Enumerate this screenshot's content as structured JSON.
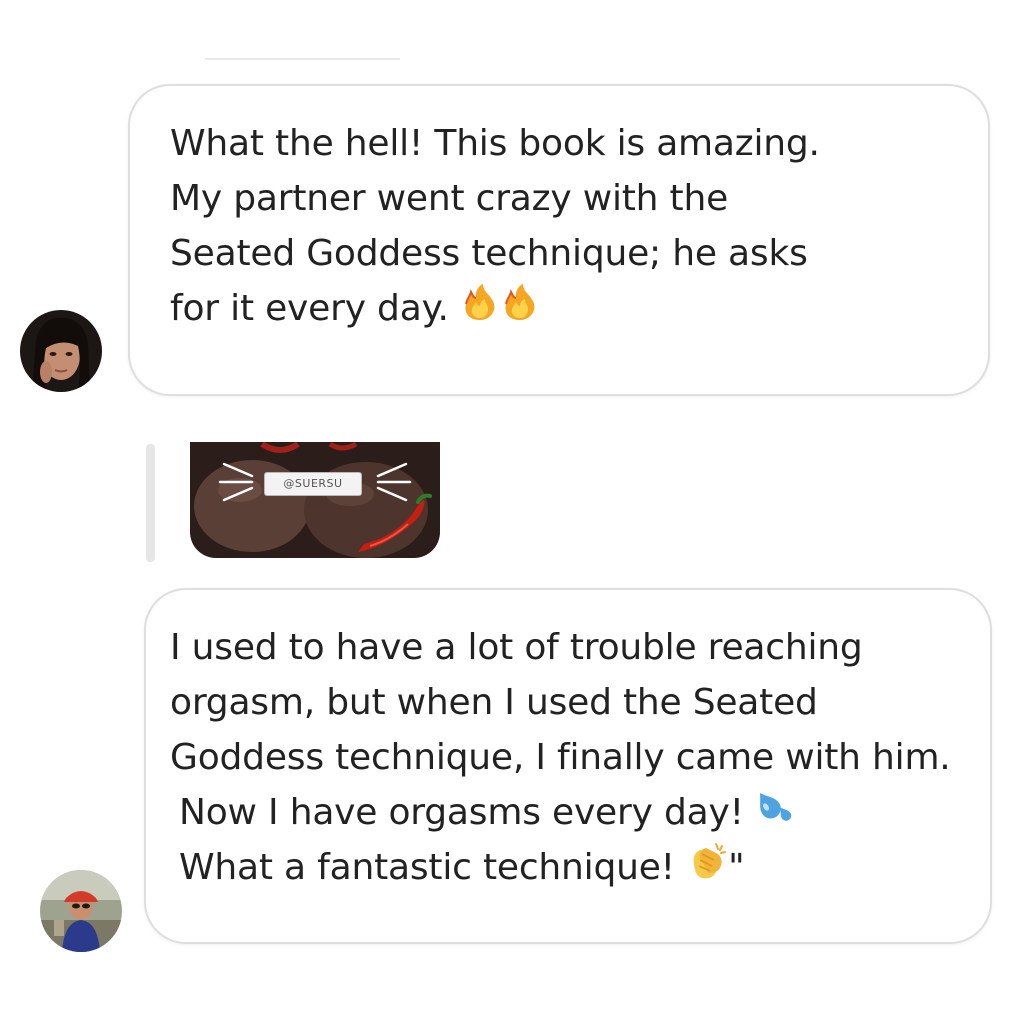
{
  "messages": [
    {
      "lines": [
        "What the hell! This book is amazing.",
        "My partner went crazy with the",
        "Seated Goddess technique; he asks",
        "for it every day."
      ],
      "emoji": [
        "fire-icon",
        "fire-icon"
      ]
    },
    {
      "lines": [
        "I used to have a lot of trouble reaching",
        "orgasm, but when I used the Seated",
        "Goddess technique, I finally came with him.",
        "Now I have orgasms every day!",
        "What a fantastic technique!"
      ],
      "trailing_text": "\"",
      "emoji": [
        "sweat-droplets-icon",
        "clapping-hands-icon"
      ]
    }
  ],
  "sticker": {
    "label": "@SUERSU"
  },
  "colors": {
    "bubble_border": "#dedede",
    "text": "#222222",
    "sticker_bg": "#2a1d1a",
    "fire": "#f5a623",
    "droplets": "#4fa3e0",
    "clap": "#f7c948",
    "pepper": "#c81e12"
  }
}
